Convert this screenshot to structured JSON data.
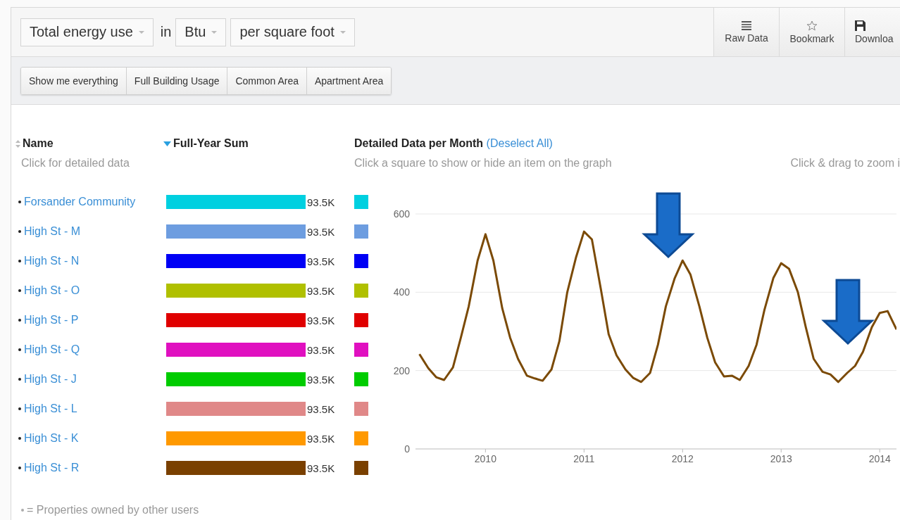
{
  "toolbar": {
    "selects": [
      {
        "value": "Total energy use"
      },
      {
        "value": "Btu"
      },
      {
        "value": "per square foot"
      }
    ],
    "connector": "in",
    "actions": [
      {
        "label": "Raw Data",
        "kind": "list"
      },
      {
        "label": "Bookmark",
        "kind": "star"
      },
      {
        "label": "Downloa",
        "kind": "save"
      }
    ]
  },
  "filters": [
    {
      "label": "Show me everything"
    },
    {
      "label": "Full Building Usage"
    },
    {
      "label": "Common Area"
    },
    {
      "label": "Apartment Area"
    }
  ],
  "table": {
    "columns": [
      {
        "label": "Name",
        "hint": "Click for detailed data"
      },
      {
        "label": "Full-Year Sum"
      }
    ],
    "rows": [
      {
        "name": "Forsander Community",
        "shared": true,
        "value": "93.5K",
        "color": "#00d0e0"
      },
      {
        "name": "High St - M",
        "shared": true,
        "value": "93.5K",
        "color": "#6d9de0"
      },
      {
        "name": "High St - N",
        "shared": true,
        "value": "93.5K",
        "color": "#0000f5"
      },
      {
        "name": "High St - O",
        "shared": true,
        "value": "93.5K",
        "color": "#b0c000"
      },
      {
        "name": "High St - P",
        "shared": true,
        "value": "93.5K",
        "color": "#e00000"
      },
      {
        "name": "High St - Q",
        "shared": true,
        "value": "93.5K",
        "color": "#e010c0"
      },
      {
        "name": "High St - J",
        "shared": true,
        "value": "93.5K",
        "color": "#00cc00"
      },
      {
        "name": "High St - L",
        "shared": true,
        "value": "93.5K",
        "color": "#e08888"
      },
      {
        "name": "High St - K",
        "shared": true,
        "value": "93.5K",
        "color": "#ff9900"
      },
      {
        "name": "High St - R",
        "shared": true,
        "value": "93.5K",
        "color": "#7a4000"
      }
    ]
  },
  "detail": {
    "title": "Detailed Data per Month",
    "link": "(Deselect All)",
    "hint": "Click a square to show or hide an item on the graph",
    "zoom_hint": "Click & drag to zoom i",
    "callouts": [
      {
        "kind": "arrow"
      },
      {
        "kind": "arrow"
      }
    ],
    "chart_data": {
      "type": "line",
      "grid": true,
      "xlim": [
        2009.29,
        2014.17
      ],
      "ylim": [
        0,
        600
      ],
      "xticks": [
        2010,
        2011,
        2012,
        2013,
        2014
      ],
      "yticks": [
        0,
        200,
        400,
        600
      ],
      "x": [
        2009.33,
        2009.42,
        2009.5,
        2009.58,
        2009.67,
        2009.75,
        2009.83,
        2009.92,
        2010,
        2010.08,
        2010.17,
        2010.25,
        2010.33,
        2010.42,
        2010.5,
        2010.58,
        2010.67,
        2010.75,
        2010.83,
        2010.92,
        2011,
        2011.08,
        2011.17,
        2011.25,
        2011.33,
        2011.42,
        2011.5,
        2011.58,
        2011.67,
        2011.75,
        2011.83,
        2011.92,
        2012,
        2012.08,
        2012.17,
        2012.25,
        2012.33,
        2012.42,
        2012.5,
        2012.58,
        2012.67,
        2012.75,
        2012.83,
        2012.92,
        2013,
        2013.08,
        2013.17,
        2013.25,
        2013.33,
        2013.42,
        2013.5,
        2013.58,
        2013.67,
        2013.75,
        2013.83,
        2013.92,
        2014,
        2014.08,
        2014.17
      ],
      "series": [
        {
          "color": "#7b4a06",
          "values": [
            242,
            206,
            183,
            176,
            208,
            284,
            364,
            481,
            548,
            481,
            359,
            284,
            230,
            187,
            180,
            174,
            203,
            275,
            400,
            490,
            555,
            535,
            409,
            293,
            239,
            203,
            181,
            171,
            194,
            266,
            364,
            436,
            481,
            445,
            364,
            284,
            221,
            185,
            187,
            176,
            212,
            266,
            355,
            436,
            474,
            460,
            400,
            311,
            230,
            197,
            190,
            171,
            194,
            212,
            248,
            311,
            347,
            352,
            305
          ]
        }
      ]
    }
  },
  "footer": {
    "legend": "= Properties owned by other users"
  }
}
